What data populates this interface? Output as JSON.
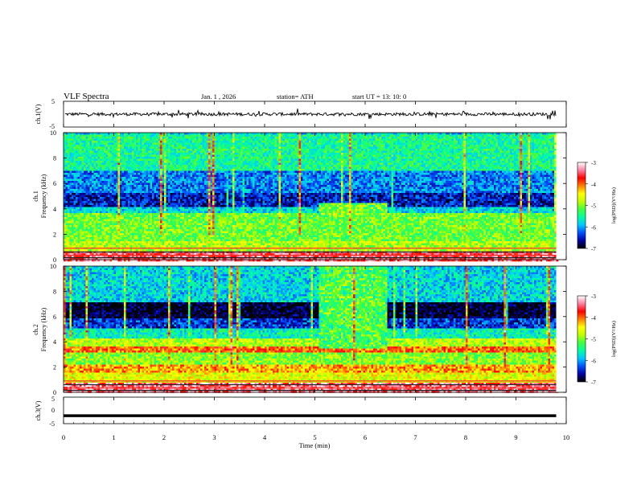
{
  "header": {
    "title": "VLF  Spectra",
    "date": "Jan.  1  , 2026",
    "station": "station= ATH",
    "start": "start  UT  =    13: 10: 0"
  },
  "colorbar": {
    "label": "log(PSD)(V²/Hz)",
    "ticks": [
      "-3",
      "-4",
      "-5",
      "-6",
      "-7"
    ],
    "colors": [
      "#000000",
      "#0000a0",
      "#0050ff",
      "#00c8ff",
      "#00ffa0",
      "#40ff40",
      "#c0ff00",
      "#ffff00",
      "#ff8000",
      "#ff0000",
      "#ff80a0",
      "#ffffff"
    ]
  },
  "chart_data": [
    {
      "type": "line",
      "panel": "ch1-waveform",
      "ylabel": "ch.1(V)",
      "ylim": [
        -5,
        5
      ],
      "yticks": [
        "5",
        "-5"
      ],
      "xlim": [
        0,
        10
      ],
      "series": [
        {
          "description": "noisy waveform centred near 0 V, roughly -1 to 1 V, with sparse spikes",
          "mean": 0,
          "amplitude": 1
        }
      ]
    },
    {
      "type": "heatmap",
      "panel": "ch1-spectrogram",
      "ylabel": "ch.1\nFrequency (kHz)",
      "ylim": [
        0,
        10
      ],
      "yticks": [
        "10",
        "8",
        "6",
        "4",
        "2",
        "0"
      ],
      "xlim": [
        0,
        10
      ],
      "data_end_min": 9.8,
      "bands": [
        {
          "from": 0,
          "to": 0.8,
          "level": 0.88
        },
        {
          "from": 0.8,
          "to": 1.5,
          "level": 0.55
        },
        {
          "from": 1.5,
          "to": 3.8,
          "level": 0.48
        },
        {
          "from": 3.8,
          "to": 4.2,
          "level": 0.3
        },
        {
          "from": 4.2,
          "to": 5.4,
          "level": 0.12
        },
        {
          "from": 5.4,
          "to": 7.0,
          "level": 0.22
        },
        {
          "from": 7.0,
          "to": 10.0,
          "level": 0.38
        }
      ],
      "event": {
        "start_min": 5.05,
        "end_min": 6.4,
        "from_khz": 3.6,
        "to_khz": 4.5,
        "level": 0.5
      }
    },
    {
      "type": "heatmap",
      "panel": "ch2-spectrogram",
      "ylabel": "ch.2\nFrequency (kHz)",
      "ylim": [
        0,
        10
      ],
      "yticks": [
        "10",
        "8",
        "6",
        "4",
        "2",
        "0"
      ],
      "xlim": [
        0,
        10
      ],
      "data_end_min": 9.8,
      "bands": [
        {
          "from": 0,
          "to": 0.8,
          "level": 0.9
        },
        {
          "from": 0.8,
          "to": 1.6,
          "level": 0.6
        },
        {
          "from": 1.6,
          "to": 2.2,
          "level": 0.7
        },
        {
          "from": 2.2,
          "to": 3.3,
          "level": 0.5
        },
        {
          "from": 3.3,
          "to": 3.7,
          "level": 0.75
        },
        {
          "from": 3.7,
          "to": 4.3,
          "level": 0.55
        },
        {
          "from": 4.3,
          "to": 5.2,
          "level": 0.35
        },
        {
          "from": 5.2,
          "to": 6.0,
          "level": 0.15
        },
        {
          "from": 6.0,
          "to": 7.2,
          "level": 0.02
        },
        {
          "from": 7.2,
          "to": 10.0,
          "level": 0.3
        }
      ],
      "event": {
        "start_min": 5.05,
        "end_min": 6.4,
        "from_khz": 3.6,
        "to_khz": 10,
        "level": 0.45
      }
    },
    {
      "type": "line",
      "panel": "ch3-waveform",
      "ylabel": "ch.3(V)",
      "ylim": [
        -5,
        5
      ],
      "yticks": [
        "5",
        "0",
        "-5"
      ],
      "xlim": [
        0,
        10
      ],
      "series": [
        {
          "description": "flat thick line",
          "value": -2
        }
      ]
    }
  ],
  "xaxis": {
    "label": "Time  (min)",
    "ticks": [
      "0",
      "1",
      "2",
      "3",
      "4",
      "5",
      "6",
      "7",
      "8",
      "9",
      "10"
    ]
  }
}
